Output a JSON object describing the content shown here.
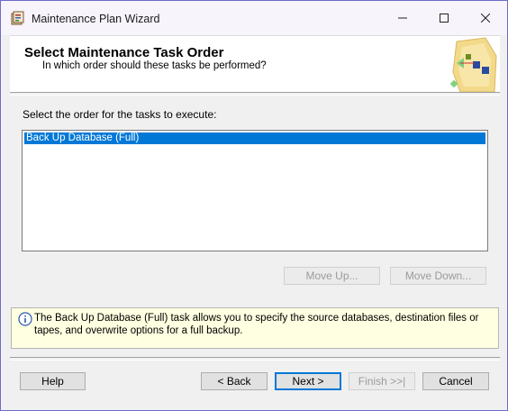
{
  "window": {
    "title": "Maintenance Plan Wizard",
    "controls": {
      "minimize": "minimize-icon",
      "maximize": "maximize-icon",
      "close": "close-icon"
    }
  },
  "header": {
    "title": "Select Maintenance Task Order",
    "subtitle": "In which order should these tasks be performed?"
  },
  "main": {
    "list_label": "Select the order for the tasks to execute:",
    "tasks": [
      "Back Up Database (Full)"
    ],
    "selected_index": 0,
    "move_up_label": "Move Up...",
    "move_down_label": "Move Down..."
  },
  "info": {
    "text": "The Back Up Database (Full) task allows you to specify the source databases, destination files or tapes, and overwrite options for a full backup."
  },
  "footer": {
    "help_label": "Help",
    "back_label": "< Back",
    "next_label": "Next >",
    "finish_label": "Finish >>|",
    "cancel_label": "Cancel"
  },
  "colors": {
    "selection": "#0078d7",
    "info_background": "#ffffe1",
    "window_border": "#6e6cc8"
  }
}
